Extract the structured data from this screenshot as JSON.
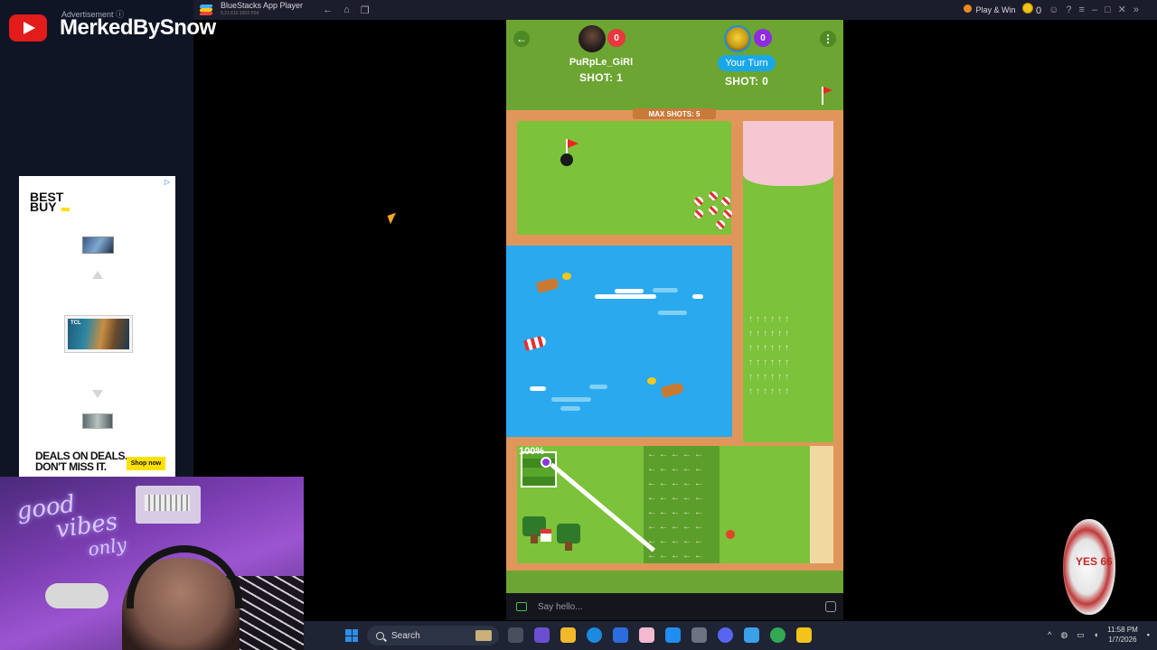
{
  "window": {
    "app_title": "BlueStacks App Player",
    "app_version": "5.21.610.1002 P64",
    "play_win_label": "Play & Win",
    "coins": "0"
  },
  "overlay": {
    "advertisement_label": "Advertisement ⓘ",
    "channel_name": "MerkedBySnow",
    "ad": {
      "brand": "BEST BUY",
      "tv_brand": "TCL",
      "headline_line1": "DEALS ON DEALS.",
      "headline_line2": "DON'T MISS IT.",
      "cta": "Shop now"
    },
    "webcam_neon_line1": "good",
    "webcam_neon_line2": "vibes",
    "webcam_neon_line3": "only"
  },
  "game": {
    "players": [
      {
        "name": "PuRpLe_GiRl",
        "score": "0",
        "shots": "SHOT: 1",
        "badge_color": "#e8383d"
      },
      {
        "name": "Your Turn",
        "score": "0",
        "shots": "SHOT: 0",
        "badge_color": "#8f2be0"
      }
    ],
    "max_shots": "MAX SHOTS: 5",
    "power": "100%",
    "chat_placeholder": "Say hello..."
  },
  "chip": {
    "label": "YES 66"
  },
  "taskbar": {
    "search_placeholder": "Search",
    "time": "11:58 PM",
    "date": "1/7/2026",
    "icons": [
      "file-explorer-icon",
      "edge-icon",
      "store-icon",
      "app-icon",
      "copilot-icon",
      "settings-icon",
      "discord-icon",
      "notepad-icon",
      "chrome-icon",
      "bluestacks-icon"
    ]
  },
  "colors": {
    "grass": "#7cc23a",
    "water": "#2aa9ee",
    "turn_pill": "#1aa7e8",
    "youtube_red": "#e21b1b"
  }
}
